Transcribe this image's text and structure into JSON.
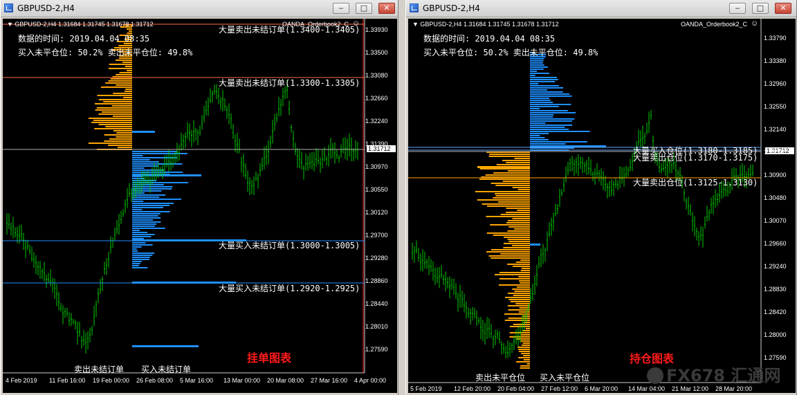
{
  "left_window": {
    "title": "GBPUSD-2,H4",
    "header": "GBPUSD-2,H4  1.31684 1.31745 1.31678 1.31712",
    "indicator": "OANDA_Orderbook2_C",
    "time_label": "数据的时间: 2019.04.04 08:35",
    "ratio_label": "买入未平仓位: 50.2%  卖出未平仓位: 49.8%",
    "annotations": [
      "大量卖出未结订单(1.3400-1.3405)",
      "大量卖出未结订单(1.3300-1.3305)",
      "大量买入未结订单(1.3000-1.3005)",
      "大量买入未结订单(1.2920-1.2925)"
    ],
    "bottom_left_label": "卖出未结订单",
    "bottom_right_label": "买入未结订单",
    "chart_title": "挂单图表",
    "prices": [
      "1.33930",
      "1.33500",
      "1.33080",
      "1.32660",
      "1.32240",
      "1.31712",
      "1.31390",
      "1.30970",
      "1.30550",
      "1.30120",
      "1.29700",
      "1.29280",
      "1.28860",
      "1.28440",
      "1.28010",
      "1.27590"
    ],
    "current_price": "1.31712",
    "dates": [
      "4 Feb 2019",
      "11 Feb 16:00",
      "19 Feb 00:00",
      "26 Feb 08:00",
      "5 Mar 16:00",
      "13 Mar 00:00",
      "20 Mar 08:00",
      "27 Mar 16:00",
      "4 Apr 00:00"
    ]
  },
  "right_window": {
    "title": "GBPUSD-2,H4",
    "header": "GBPUSD-2,H4  1.31684 1.31745 1.31678 1.31712",
    "indicator": "OANDA_Orderbook2_C",
    "time_label": "数据的时间: 2019.04.04 08:35",
    "ratio_label": "买入未平仓位: 50.2%  卖出未平仓位: 49.8%",
    "annotations": [
      "大量买入仓位(1.3180-1.3185)",
      "大量卖出仓位(1.3170-1.3175)",
      "大量卖出仓位(1.3125-1.3130)"
    ],
    "bottom_left_label": "卖出未平仓位",
    "bottom_right_label": "买入未平仓位",
    "chart_title": "持仓图表",
    "prices": [
      "1.33790",
      "1.33380",
      "1.32960",
      "1.32550",
      "1.32140",
      "1.31712",
      "1.31310",
      "1.30900",
      "1.30480",
      "1.30070",
      "1.29660",
      "1.29240",
      "1.28830",
      "1.28420",
      "1.28000",
      "1.27590"
    ],
    "current_price": "1.31712",
    "dates": [
      "5 Feb 2019",
      "12 Feb 20:00",
      "20 Feb 04:00",
      "27 Feb 12:00",
      "6 Mar 20:00",
      "14 Mar 04:00",
      "21 Mar 12:00",
      "28 Mar 20:00"
    ]
  },
  "watermark": {
    "brand": "FX678",
    "suffix": "汇通网"
  },
  "colors": {
    "candle": "#00c800",
    "sell": "#ffa500",
    "buy": "#1e90ff",
    "bg": "#000000",
    "hline_red": "#ff6a4a",
    "hline_blue": "#1e90ff"
  },
  "window_controls": {
    "minimize": "‒",
    "maximize": "□",
    "close": "✕"
  }
}
